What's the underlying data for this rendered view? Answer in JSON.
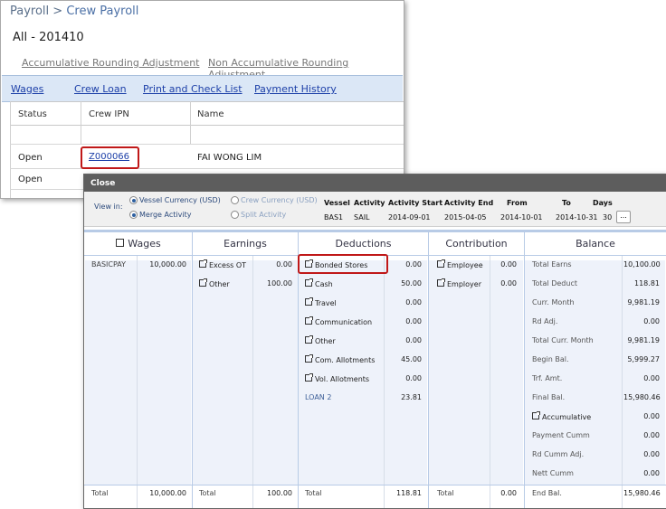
{
  "back": {
    "breadcrumb_root": "Payroll",
    "breadcrumb_sep": ">",
    "breadcrumb_current": "Crew Payroll",
    "period": "All - 201410",
    "adj_accum": "Accumulative Rounding Adjustment",
    "adj_nonaccum": "Non Accumulative Rounding Adjustment",
    "tabs": [
      "Wages",
      "Crew Loan",
      "Print and Check List",
      "Payment History"
    ],
    "columns": [
      "Status",
      "Crew IPN",
      "Name"
    ],
    "rows": [
      {
        "status": "Open",
        "ipn": "Z000066",
        "name": "FAI WONG LIM"
      },
      {
        "status": "Open",
        "ipn": "",
        "name": ""
      }
    ]
  },
  "dialog": {
    "title": "Close",
    "view_in_label": "View in:",
    "radio_vessel": "Vessel Currency (USD)",
    "radio_crew": "Crew Currency (USD)",
    "radio_merge": "Merge Activity",
    "radio_split": "Split Activity",
    "headers": [
      "Vessel",
      "Activity",
      "Activity Start",
      "Activity End",
      "From",
      "To",
      "Days"
    ],
    "values": [
      "BAS1",
      "SAIL",
      "2014-09-01",
      "2015-04-05",
      "2014-10-01",
      "2014-10-31",
      "30"
    ],
    "more_btn": "...",
    "sections": {
      "wages": "Wages",
      "earnings": "Earnings",
      "deductions": "Deductions",
      "contribution": "Contribution",
      "balance": "Balance"
    },
    "wages_rows": [
      {
        "label": "BASICPAY",
        "value": "10,000.00"
      }
    ],
    "earnings_rows": [
      {
        "label": "Excess OT",
        "value": "0.00"
      },
      {
        "label": "Other",
        "value": "100.00"
      }
    ],
    "deductions_rows": [
      {
        "label": "Bonded Stores",
        "value": "0.00"
      },
      {
        "label": "Cash",
        "value": "50.00"
      },
      {
        "label": "Travel",
        "value": "0.00"
      },
      {
        "label": "Communication",
        "value": "0.00"
      },
      {
        "label": "Other",
        "value": "0.00"
      },
      {
        "label": "Com. Allotments",
        "value": "45.00"
      },
      {
        "label": "Vol. Allotments",
        "value": "0.00"
      },
      {
        "label": "LOAN 2",
        "value": "23.81"
      }
    ],
    "contribution_rows": [
      {
        "label": "Employee",
        "value": "0.00"
      },
      {
        "label": "Employer",
        "value": "0.00"
      }
    ],
    "balance_rows": [
      {
        "label": "Total Earns",
        "value": "10,100.00"
      },
      {
        "label": "Total Deduct",
        "value": "118.81"
      },
      {
        "label": "Curr. Month",
        "value": "9,981.19"
      },
      {
        "label": "Rd Adj.",
        "value": "0.00"
      },
      {
        "label": "Total Curr. Month",
        "value": "9,981.19"
      },
      {
        "label": "Begin Bal.",
        "value": "5,999.27"
      },
      {
        "label": "Trf. Amt.",
        "value": "0.00"
      },
      {
        "label": "Final Bal.",
        "value": "15,980.46"
      },
      {
        "label": "Accumulative",
        "value": "0.00"
      },
      {
        "label": "Payment Cumm",
        "value": "0.00"
      },
      {
        "label": "Rd Cumm Adj.",
        "value": "0.00"
      },
      {
        "label": "Nett Cumm",
        "value": "0.00"
      }
    ],
    "totals": {
      "wages_label": "Total",
      "wages_value": "10,000.00",
      "earnings_label": "Total",
      "earnings_value": "100.00",
      "deductions_label": "Total",
      "deductions_value": "118.81",
      "contribution_label": "Total",
      "contribution_value": "0.00",
      "balance_label": "End Bal.",
      "balance_value": "15,980.46"
    }
  }
}
